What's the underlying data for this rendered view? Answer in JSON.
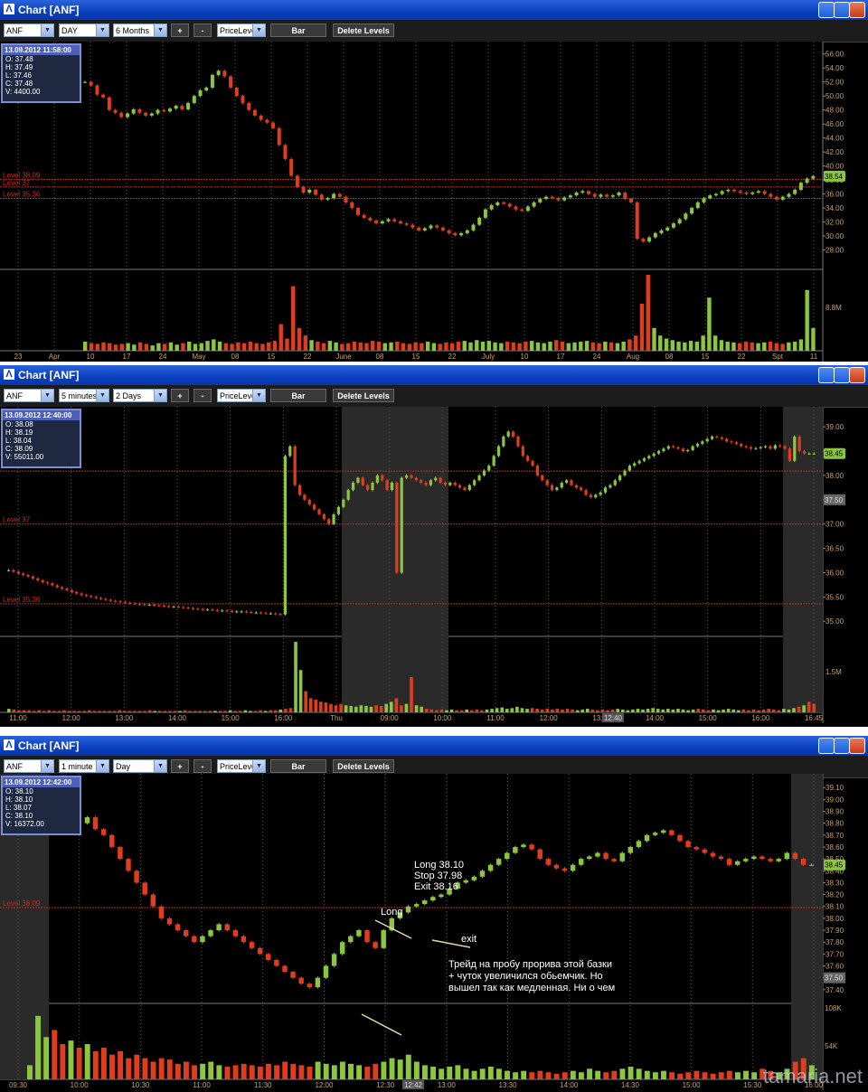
{
  "windows": [
    {
      "title": "Chart [ANF]",
      "symbol": "ANF",
      "interval": "DAY",
      "range": "6 Months",
      "study": "PriceLeve",
      "plus": "+",
      "minus": "-",
      "bar_label": "Bar",
      "delete_levels": "Delete Levels",
      "info": {
        "time": "13.09.2012 11:58:00",
        "o": "O: 37.48",
        "h": "H: 37.49",
        "l": "L: 37.46",
        "c": "C: 37.48",
        "v": "V: 4400.00"
      }
    },
    {
      "title": "Chart [ANF]",
      "symbol": "ANF",
      "interval": "5 minutes",
      "range": "2 Days",
      "study": "PriceLeve",
      "plus": "+",
      "minus": "-",
      "bar_label": "Bar",
      "delete_levels": "Delete Levels",
      "info": {
        "time": "13.09.2012 12:40:00",
        "o": "O: 38.08",
        "h": "H: 38.19",
        "l": "L: 38.04",
        "c": "C: 38.09",
        "v": "V: 55011.00"
      }
    },
    {
      "title": "Chart [ANF]",
      "symbol": "ANF",
      "interval": "1 minute",
      "range": "Day",
      "study": "PriceLeve",
      "plus": "+",
      "minus": "-",
      "bar_label": "Bar",
      "delete_levels": "Delete Levels",
      "info": {
        "time": "13.09.2012 12:42:00",
        "o": "O: 38.10",
        "h": "H: 38.10",
        "l": "L: 38.07",
        "c": "C: 38.10",
        "v": "V: 16372.00"
      }
    }
  ],
  "colors": {
    "up": "#8cc63f",
    "down": "#e03c1e",
    "level": "#c8281e",
    "axis_text": "#c8a064",
    "grid": "#555555"
  },
  "chart_data": [
    {
      "type": "candlestick",
      "title": "",
      "y_ticks": [
        "56.00",
        "54.00",
        "52.00",
        "50.00",
        "48.00",
        "46.00",
        "44.00",
        "42.00",
        "40.00",
        "38.00",
        "36.00",
        "34.00",
        "32.00",
        "30.00",
        "28.00"
      ],
      "x_ticks": [
        "23",
        "Apr",
        "10",
        "17",
        "24",
        "May",
        "08",
        "15",
        "22",
        "June",
        "08",
        "15",
        "22",
        "July",
        "10",
        "17",
        "24",
        "Aug",
        "08",
        "15",
        "22",
        "Spt",
        "11"
      ],
      "ylim": [
        26,
        57
      ],
      "levels": [
        {
          "label": "Level 38.09",
          "value": 38.09
        },
        {
          "label": "Level 37",
          "value": 37
        },
        {
          "label": "Level 35.36",
          "value": 35.36
        }
      ],
      "last_price": "38.54",
      "volume_tick": "8.8M",
      "closes": [
        52,
        51.5,
        50.2,
        49.8,
        48,
        47.6,
        47,
        47.5,
        48.1,
        47.6,
        47.2,
        47.5,
        48,
        47.8,
        48.2,
        48.6,
        48.1,
        49,
        50,
        50.8,
        51.2,
        53,
        53.6,
        52.8,
        51.2,
        50,
        49,
        48,
        47.2,
        46.6,
        46.2,
        45.4,
        43,
        41,
        38.6,
        37,
        36.2,
        36.6,
        35.9,
        35.2,
        35.4,
        36,
        35.6,
        34.8,
        34,
        33,
        32.6,
        32.2,
        31.8,
        32.1,
        32.4,
        32.1,
        31.8,
        31.6,
        31.2,
        30.8,
        31.1,
        31.5,
        31.2,
        30.8,
        30.4,
        30.1,
        30.4,
        30.8,
        31.6,
        32.6,
        33.8,
        34.4,
        34.8,
        34.6,
        34.2,
        33.8,
        33.6,
        34.2,
        34.8,
        35.3,
        35.6,
        35.4,
        35.1,
        35.5,
        35.8,
        36.2,
        36.4,
        36,
        35.6,
        35.9,
        35.6,
        35.8,
        36.2,
        35.3,
        34.8,
        29.6,
        29.2,
        29.8,
        30.4,
        30.8,
        31.2,
        31.8,
        32.4,
        33.2,
        34,
        34.8,
        35.4,
        35.8,
        36,
        36.4,
        36.6,
        36.4,
        36.2,
        36,
        36.2,
        36.4,
        36,
        35.6,
        35.2,
        35.6,
        36,
        36.6,
        37.6,
        38.2,
        38.54
      ],
      "volumes": [
        0.12,
        0.1,
        0.09,
        0.11,
        0.1,
        0.08,
        0.09,
        0.1,
        0.08,
        0.11,
        0.09,
        0.07,
        0.1,
        0.09,
        0.11,
        0.08,
        0.1,
        0.12,
        0.09,
        0.1,
        0.13,
        0.15,
        0.12,
        0.1,
        0.09,
        0.11,
        0.1,
        0.12,
        0.1,
        0.09,
        0.11,
        0.13,
        0.35,
        0.16,
        0.85,
        0.3,
        0.2,
        0.14,
        0.12,
        0.1,
        0.13,
        0.11,
        0.09,
        0.1,
        0.12,
        0.11,
        0.1,
        0.13,
        0.12,
        0.1,
        0.11,
        0.12,
        0.1,
        0.09,
        0.11,
        0.1,
        0.12,
        0.1,
        0.09,
        0.11,
        0.1,
        0.12,
        0.13,
        0.11,
        0.14,
        0.12,
        0.13,
        0.11,
        0.1,
        0.12,
        0.11,
        0.1,
        0.12,
        0.13,
        0.11,
        0.1,
        0.12,
        0.14,
        0.12,
        0.1,
        0.11,
        0.12,
        0.13,
        0.11,
        0.1,
        0.12,
        0.11,
        0.1,
        0.12,
        0.15,
        0.2,
        0.62,
        1.0,
        0.3,
        0.2,
        0.16,
        0.14,
        0.12,
        0.11,
        0.13,
        0.12,
        0.2,
        0.7,
        0.2,
        0.14,
        0.12,
        0.11,
        0.1,
        0.12,
        0.11,
        0.1,
        0.11,
        0.12,
        0.1,
        0.09,
        0.11,
        0.12,
        0.15,
        0.8,
        0.3
      ]
    },
    {
      "type": "candlestick",
      "title": "",
      "y_ticks": [
        "39.00",
        "38.50",
        "38.00",
        "37.50",
        "37.00",
        "36.50",
        "36.00",
        "35.50",
        "35.00"
      ],
      "x_ticks": [
        "11:00",
        "12:00",
        "13:00",
        "14:00",
        "15:00",
        "16:00",
        "Thu",
        "09:00",
        "10:00",
        "11:00",
        "12:00",
        "13:00",
        "14:00",
        "15:00",
        "16:00",
        "16:45"
      ],
      "ylim": [
        34.8,
        39.3
      ],
      "levels": [
        {
          "label": "",
          "value": 38.09
        },
        {
          "label": "Level 37",
          "value": 37
        },
        {
          "label": "Level 35.36",
          "value": 35.36
        }
      ],
      "last_price": "38.45",
      "cursor_price": "37.50",
      "cursor_time": "12:40",
      "volume_tick": "1.5M",
      "closes": [
        36.05,
        36.02,
        35.98,
        35.95,
        35.92,
        35.88,
        35.84,
        35.8,
        35.78,
        35.74,
        35.7,
        35.67,
        35.64,
        35.6,
        35.57,
        35.54,
        35.52,
        35.5,
        35.48,
        35.46,
        35.44,
        35.42,
        35.41,
        35.4,
        35.38,
        35.37,
        35.36,
        35.35,
        35.34,
        35.34,
        35.33,
        35.32,
        35.31,
        35.3,
        35.3,
        35.29,
        35.28,
        35.27,
        35.26,
        35.25,
        35.24,
        35.24,
        35.23,
        35.22,
        35.22,
        35.21,
        35.2,
        35.2,
        35.2,
        35.19,
        35.18,
        35.18,
        35.17,
        35.16,
        35.16,
        35.15,
        35.14,
        38.4,
        38.6,
        37.8,
        37.6,
        37.5,
        37.4,
        37.3,
        37.2,
        37.1,
        37.0,
        37.2,
        37.35,
        37.5,
        37.7,
        37.85,
        37.95,
        37.8,
        37.7,
        37.85,
        38.0,
        37.9,
        37.7,
        37.85,
        36.0,
        37.95,
        38.0,
        37.95,
        37.9,
        37.85,
        37.8,
        37.9,
        37.95,
        37.85,
        37.8,
        37.85,
        37.8,
        37.75,
        37.7,
        37.8,
        37.9,
        38.0,
        38.1,
        38.2,
        38.4,
        38.6,
        38.8,
        38.9,
        38.8,
        38.6,
        38.4,
        38.3,
        38.2,
        38.0,
        37.9,
        37.8,
        37.7,
        37.75,
        37.85,
        37.9,
        37.8,
        37.75,
        37.7,
        37.6,
        37.55,
        37.6,
        37.65,
        37.75,
        37.8,
        37.9,
        38.0,
        38.1,
        38.2,
        38.25,
        38.3,
        38.35,
        38.4,
        38.45,
        38.5,
        38.55,
        38.6,
        38.58,
        38.55,
        38.5,
        38.52,
        38.6,
        38.65,
        38.7,
        38.75,
        38.8,
        38.78,
        38.75,
        38.7,
        38.68,
        38.65,
        38.6,
        38.58,
        38.55,
        38.56,
        38.58,
        38.6,
        38.55,
        38.62,
        38.6,
        38.55,
        38.3,
        38.8,
        38.5,
        38.45,
        38.45,
        38.45
      ],
      "volumes": [
        0.05,
        0.04,
        0.03,
        0.03,
        0.03,
        0.02,
        0.03,
        0.02,
        0.03,
        0.02,
        0.02,
        0.03,
        0.02,
        0.02,
        0.02,
        0.02,
        0.03,
        0.02,
        0.02,
        0.02,
        0.02,
        0.02,
        0.03,
        0.02,
        0.02,
        0.02,
        0.02,
        0.02,
        0.03,
        0.02,
        0.02,
        0.02,
        0.02,
        0.02,
        0.02,
        0.03,
        0.02,
        0.02,
        0.02,
        0.02,
        0.02,
        0.02,
        0.02,
        0.02,
        0.03,
        0.02,
        0.02,
        0.03,
        0.02,
        0.02,
        0.03,
        0.02,
        0.03,
        0.03,
        0.04,
        0.05,
        0.06,
        1.0,
        0.6,
        0.3,
        0.2,
        0.18,
        0.15,
        0.14,
        0.12,
        0.1,
        0.12,
        0.1,
        0.09,
        0.08,
        0.1,
        0.09,
        0.08,
        0.1,
        0.09,
        0.12,
        0.15,
        0.2,
        0.1,
        0.12,
        0.5,
        0.1,
        0.08,
        0.05,
        0.04,
        0.03,
        0.04,
        0.03,
        0.04,
        0.03,
        0.03,
        0.04,
        0.03,
        0.04,
        0.03,
        0.04,
        0.05,
        0.06,
        0.07,
        0.05,
        0.06,
        0.08,
        0.06,
        0.05,
        0.06,
        0.05,
        0.04,
        0.05,
        0.04,
        0.05,
        0.04,
        0.05,
        0.04,
        0.03,
        0.04,
        0.05,
        0.04,
        0.03,
        0.04,
        0.03,
        0.04,
        0.05,
        0.04,
        0.03,
        0.04,
        0.05,
        0.04,
        0.05,
        0.06,
        0.05,
        0.04,
        0.05,
        0.04,
        0.05,
        0.04,
        0.03,
        0.04,
        0.05,
        0.04,
        0.03,
        0.04,
        0.03,
        0.04,
        0.05,
        0.04,
        0.03,
        0.04,
        0.03,
        0.04,
        0.03,
        0.04,
        0.05,
        0.04,
        0.03,
        0.05,
        0.04,
        0.06,
        0.08,
        0.1,
        0.15,
        0.12
      ]
    },
    {
      "type": "candlestick",
      "title": "",
      "y_ticks": [
        "39.10",
        "39.00",
        "38.90",
        "38.80",
        "38.70",
        "38.60",
        "38.50",
        "38.40",
        "38.30",
        "38.20",
        "38.10",
        "38.00",
        "37.90",
        "37.80",
        "37.70",
        "37.60",
        "37.50",
        "37.40"
      ],
      "x_ticks": [
        "09:30",
        "10:00",
        "10:30",
        "11:00",
        "11:30",
        "12:00",
        "12:30",
        "13:00",
        "13:30",
        "14:00",
        "14:30",
        "15:00",
        "15:30",
        "16:00"
      ],
      "ylim": [
        37.33,
        39.17
      ],
      "levels": [
        {
          "label": "Level 38.09",
          "value": 38.09
        }
      ],
      "last_price": "38.45",
      "cursor_price": "37.50",
      "cursor_time": "12:42",
      "volume_ticks": [
        "108K",
        "54K"
      ],
      "annotations": {
        "trade": [
          "Long 38.10",
          "Stop 37.98",
          "Exit 38.16"
        ],
        "long_label": "Long",
        "exit_label": "exit",
        "comment": [
          "Трейд на пробу прорива этой базки",
          "+ чуток увеличился обьемчик. Но",
          "вышел так как медленная. Ни о чем"
        ]
      },
      "closes": [
        38.8,
        38.9,
        39.0,
        38.95,
        38.85,
        38.9,
        38.8,
        38.85,
        38.75,
        38.7,
        38.6,
        38.5,
        38.4,
        38.3,
        38.2,
        38.1,
        38.0,
        37.95,
        37.9,
        37.85,
        37.8,
        37.85,
        37.9,
        37.95,
        37.9,
        37.85,
        37.8,
        37.75,
        37.7,
        37.65,
        37.6,
        37.55,
        37.5,
        37.45,
        37.42,
        37.5,
        37.6,
        37.7,
        37.8,
        37.85,
        37.9,
        37.8,
        37.75,
        37.9,
        38.0,
        38.05,
        38.1,
        38.12,
        38.15,
        38.18,
        38.2,
        38.25,
        38.3,
        38.32,
        38.35,
        38.4,
        38.45,
        38.5,
        38.55,
        38.6,
        38.62,
        38.58,
        38.5,
        38.45,
        38.42,
        38.4,
        38.45,
        38.5,
        38.52,
        38.55,
        38.5,
        38.48,
        38.55,
        38.6,
        38.65,
        38.7,
        38.72,
        38.74,
        38.7,
        38.65,
        38.6,
        38.58,
        38.55,
        38.52,
        38.5,
        38.45,
        38.48,
        38.5,
        38.52,
        38.5,
        38.48,
        38.5,
        38.55,
        38.5,
        38.45,
        38.45
      ],
      "volumes": [
        0.2,
        0.9,
        0.6,
        0.7,
        0.5,
        0.55,
        0.45,
        0.5,
        0.4,
        0.45,
        0.35,
        0.4,
        0.3,
        0.35,
        0.3,
        0.25,
        0.3,
        0.28,
        0.22,
        0.25,
        0.2,
        0.22,
        0.25,
        0.2,
        0.18,
        0.2,
        0.22,
        0.2,
        0.18,
        0.22,
        0.2,
        0.25,
        0.22,
        0.2,
        0.18,
        0.25,
        0.22,
        0.2,
        0.25,
        0.22,
        0.2,
        0.18,
        0.22,
        0.25,
        0.3,
        0.28,
        0.35,
        0.25,
        0.2,
        0.18,
        0.15,
        0.18,
        0.2,
        0.15,
        0.12,
        0.15,
        0.18,
        0.15,
        0.12,
        0.1,
        0.12,
        0.1,
        0.12,
        0.1,
        0.08,
        0.1,
        0.12,
        0.1,
        0.15,
        0.12,
        0.1,
        0.12,
        0.15,
        0.18,
        0.15,
        0.12,
        0.1,
        0.12,
        0.1,
        0.08,
        0.1,
        0.12,
        0.1,
        0.08,
        0.1,
        0.12,
        0.1,
        0.12,
        0.1,
        0.15,
        0.12,
        0.1,
        0.15,
        0.25,
        0.3,
        0.2
      ]
    }
  ],
  "watermark": "tamaria.net"
}
